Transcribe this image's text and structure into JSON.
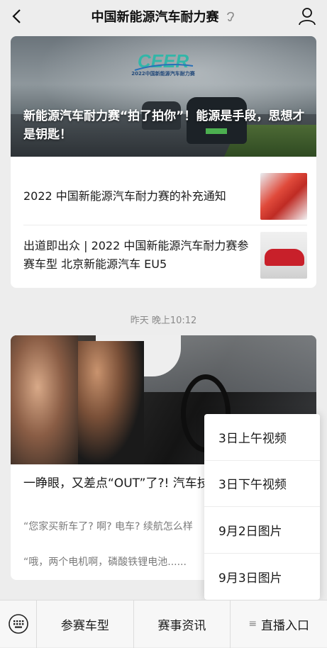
{
  "header": {
    "title": "中国新能源汽车耐力赛",
    "icons": {
      "back": "back-arrow-icon",
      "ear": "ear-icon",
      "profile": "profile-icon"
    }
  },
  "card1": {
    "cover_caption": "新能源汽车耐力赛“拍了拍你”！能源是手段，思想才是钥匙！",
    "logo_text": "2022中国新能源汽车耐力赛",
    "articles": [
      {
        "title": "2022 中国新能源汽车耐力赛的补充通知"
      },
      {
        "title": "出道即出众 | 2022 中国新能源汽车耐力赛参赛车型 北京新能源汽车 EU5"
      }
    ]
  },
  "timestamp": "昨天 晚上10:12",
  "card2": {
    "title": "一睁眼，又差点“OUT”了?! 汽车技术都什么样了?",
    "title_visible": "一睁眼，又差点“OUT”了?! 汽车技术都什么样了?",
    "excerpt1": "“您家买新车了? 啊? 电车? 续航怎么样",
    "excerpt2": "“哦，两个电机啊，磷酸铁锂电池......"
  },
  "popup_menu": {
    "items": [
      "3日上午视频",
      "3日下午视频",
      "9月2日图片",
      "9月3日图片"
    ]
  },
  "bottom_menu": {
    "keyboard_icon": "keyboard-icon",
    "items": [
      "参赛车型",
      "赛事资讯",
      "直播入口"
    ]
  },
  "colors": {
    "background": "#ededed",
    "card": "#ffffff",
    "text": "#191919",
    "muted": "#8a8a8a"
  }
}
